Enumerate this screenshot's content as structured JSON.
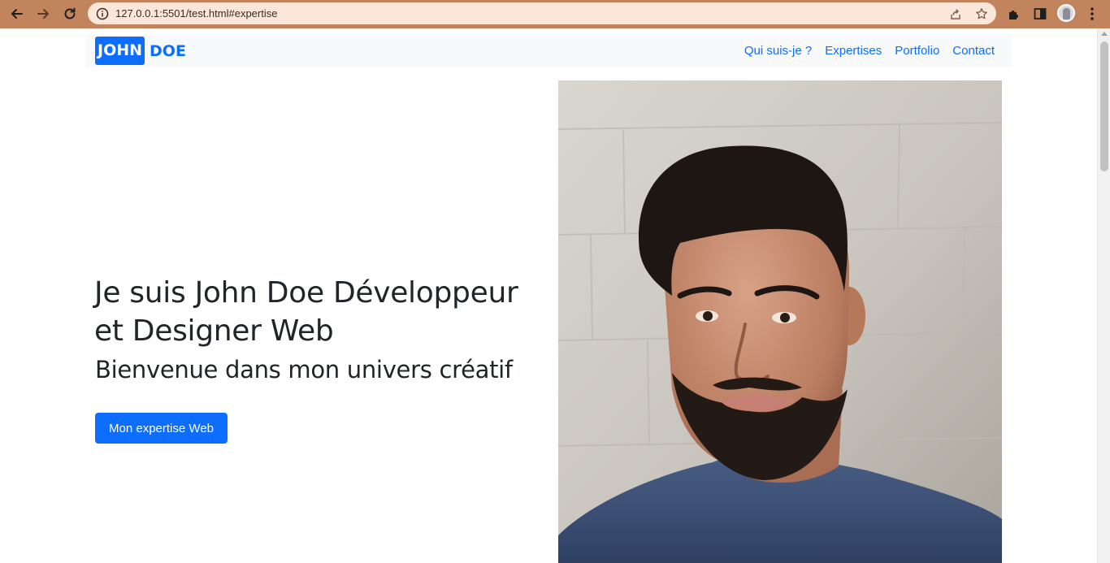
{
  "browser": {
    "url": "127.0.0.1:5501/test.html#expertise",
    "icons": [
      "back-arrow-icon",
      "forward-arrow-icon",
      "reload-icon",
      "info-icon",
      "share-icon",
      "star-icon",
      "extensions-icon",
      "side-panel-icon",
      "profile-avatar",
      "menu-dots-icon"
    ],
    "accent": "#c2845c"
  },
  "navbar": {
    "brand_first": "JOHN",
    "brand_second": "DOE",
    "links": [
      "Qui suis-je ?",
      "Expertises",
      "Portfolio",
      "Contact"
    ]
  },
  "hero": {
    "title": "Je suis John Doe Développeur et Designer Web",
    "subtitle": "Bienvenue dans mon univers créatif",
    "button_label": "Mon expertise Web",
    "photo": "portrait-photo"
  },
  "colors": {
    "primary": "#0d6efd",
    "text": "#212529",
    "navbar_bg": "#f8f9fa"
  }
}
